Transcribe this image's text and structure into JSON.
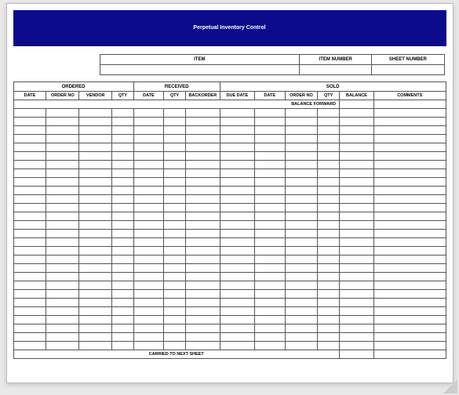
{
  "banner": {
    "title": "Perpetual Inventory Control"
  },
  "info": {
    "item_hdr": "ITEM",
    "item_no_hdr": "ITEM NUMBER",
    "sheet_no_hdr": "SHEET NUMBER",
    "item_val": "",
    "item_no_val": "",
    "sheet_no_val": ""
  },
  "groups": {
    "ordered": "ORDERED",
    "received": "RECEIVED",
    "sold": "SOLD"
  },
  "cols": {
    "date": "DATE",
    "orderno": "ORDER NO",
    "vendor": "VENDOR",
    "qty": "QTY",
    "rdate": "DATE",
    "rqty": "QTY",
    "rback": "BACKORDER",
    "duedate": "DUE DATE",
    "sdate": "DATE",
    "sorder": "ORDER NO",
    "sqty": "QTY",
    "balance": "BALANCE",
    "comments": "COMMENTS"
  },
  "balance_forward": "BALANCE FORWARD",
  "carried": "CARRIED TO NEXT SHEET",
  "row_count": 28
}
